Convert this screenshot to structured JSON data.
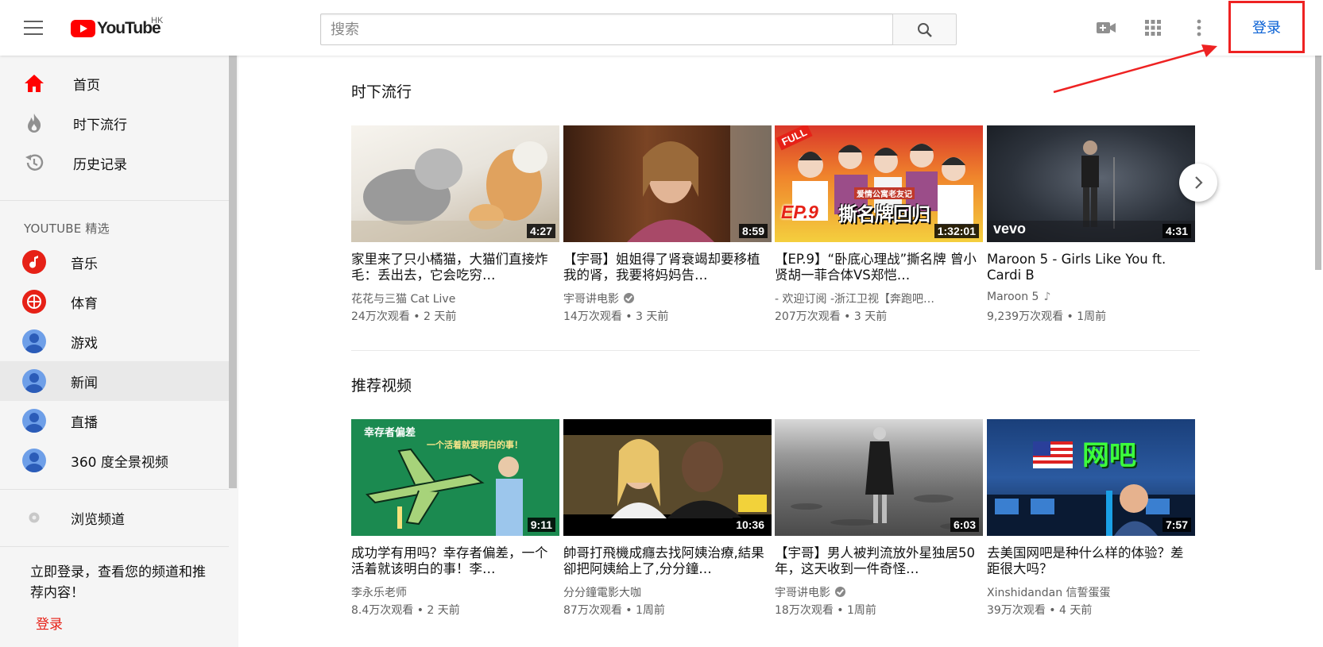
{
  "header": {
    "logo_text": "YouTube",
    "region": "HK",
    "search_placeholder": "搜索",
    "sign_in": "登录"
  },
  "sidebar": {
    "main_items": [
      {
        "label": "首页",
        "icon": "home-icon"
      },
      {
        "label": "时下流行",
        "icon": "trending-flame-icon"
      },
      {
        "label": "历史记录",
        "icon": "history-icon"
      }
    ],
    "section_title": "YOUTUBE 精选",
    "best_items": [
      {
        "label": "音乐",
        "icon": "music-channel-icon"
      },
      {
        "label": "体育",
        "icon": "sports-channel-icon"
      },
      {
        "label": "游戏",
        "icon": "gaming-avatar-icon"
      },
      {
        "label": "新闻",
        "icon": "news-avatar-icon"
      },
      {
        "label": "直播",
        "icon": "live-avatar-icon"
      },
      {
        "label": "360 度全景视频",
        "icon": "360-video-avatar-icon"
      }
    ],
    "browse_channels": "浏览频道",
    "promo_text": "立即登录，查看您的频道和推荐内容！",
    "promo_sign_in": "登录"
  },
  "sections": [
    {
      "title": "时下流行",
      "videos": [
        {
          "title": "家里来了只小橘猫，大猫们直接炸毛：丢出去，它会吃穷…",
          "channel": "花花与三猫 Cat Live",
          "meta": "24万次观看 • 2 天前",
          "duration": "4:27",
          "verified": false,
          "music": false
        },
        {
          "title": "【宇哥】姐姐得了肾衰竭却要移植我的肾，我要将妈妈告…",
          "channel": "宇哥讲电影",
          "meta": "14万次观看 • 3 天前",
          "duration": "8:59",
          "verified": true,
          "music": false
        },
        {
          "title": "【EP.9】“卧底心理战”撕名牌 曾小贤胡一菲合体VS郑恺…",
          "channel": "- 欢迎订阅 -浙江卫视【奔跑吧…",
          "meta": "207万次观看 • 3 天前",
          "duration": "1:32:01",
          "verified": false,
          "music": false
        },
        {
          "title": "Maroon 5 - Girls Like You ft. Cardi B",
          "channel": "Maroon 5",
          "meta": "9,239万次观看 • 1周前",
          "duration": "4:31",
          "verified": false,
          "music": true
        }
      ]
    },
    {
      "title": "推荐视频",
      "videos": [
        {
          "title": "成功学有用吗？幸存者偏差，一个活着就该明白的事！李…",
          "channel": "李永乐老师",
          "meta": "8.4万次观看 • 2 天前",
          "duration": "9:11",
          "verified": false,
          "music": false
        },
        {
          "title": "帥哥打飛機成癮去找阿姨治療,結果卻把阿姨給上了,分分鐘…",
          "channel": "分分鐘電影大咖",
          "meta": "87万次观看 • 1周前",
          "duration": "10:36",
          "verified": false,
          "music": false
        },
        {
          "title": "【宇哥】男人被判流放外星独居50年，这天收到一件奇怪…",
          "channel": "宇哥讲电影",
          "meta": "18万次观看 • 1周前",
          "duration": "6:03",
          "verified": true,
          "music": false
        },
        {
          "title": "去美国网吧是种什么样的体验？差距很大吗？",
          "channel": "Xinshidandan 信誓蛋蛋",
          "meta": "39万次观看 • 4 天前",
          "duration": "7:57",
          "verified": false,
          "music": false
        }
      ]
    }
  ],
  "thumbnail_texts": {
    "t_full": "FULL",
    "t_ep9": "EP.9",
    "t_show": "撕名牌回归",
    "t_show_sub": "爱情公寓老友记",
    "t_vevo": "vevo",
    "r_survivor": "幸存者偏差",
    "r_survivor_sub": "一个活着就要明白的事！",
    "r_netbar": "网吧"
  },
  "colors": {
    "brand_red": "#ff0000",
    "link_blue": "#065fd4",
    "annotation_red": "#ee2222"
  }
}
